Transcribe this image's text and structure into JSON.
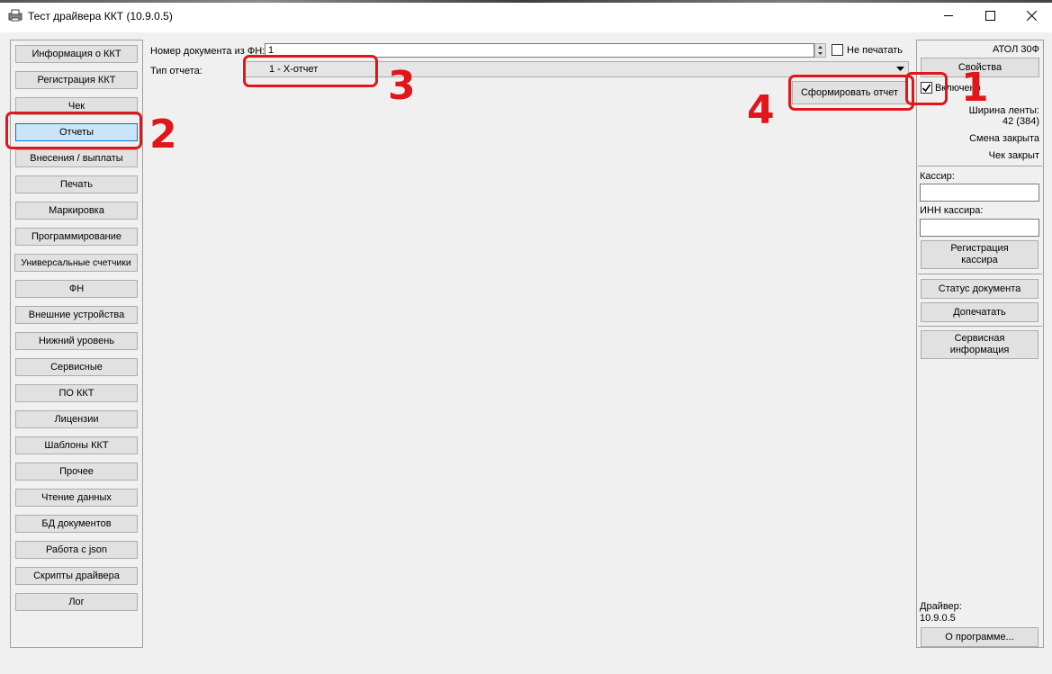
{
  "window": {
    "title": "Тест драйвера ККТ (10.9.0.5)"
  },
  "nav": {
    "items": [
      {
        "label": "Информация о ККТ"
      },
      {
        "label": "Регистрация ККТ"
      },
      {
        "label": "Чек"
      },
      {
        "label": "Отчеты"
      },
      {
        "label": "Внесения / выплаты"
      },
      {
        "label": "Печать"
      },
      {
        "label": "Маркировка"
      },
      {
        "label": "Программирование"
      },
      {
        "label": "Универсальные счетчики"
      },
      {
        "label": "ФН"
      },
      {
        "label": "Внешние устройства"
      },
      {
        "label": "Нижний уровень"
      },
      {
        "label": "Сервисные"
      },
      {
        "label": "ПО ККТ"
      },
      {
        "label": "Лицензии"
      },
      {
        "label": "Шаблоны ККТ"
      },
      {
        "label": "Прочее"
      },
      {
        "label": "Чтение данных"
      },
      {
        "label": "БД документов"
      },
      {
        "label": "Работа с json"
      },
      {
        "label": "Скрипты драйвера"
      },
      {
        "label": "Лог"
      }
    ],
    "selected": "Отчеты"
  },
  "main": {
    "doc_number_label": "Номер документа из ФН:",
    "doc_number_value": "1",
    "no_print_label": "Не печатать",
    "no_print_checked": false,
    "report_type_label": "Тип отчета:",
    "report_type_value": "1 - X-отчет",
    "generate_button": "Сформировать отчет"
  },
  "right": {
    "device_name": "АТОЛ 30Ф",
    "properties_button": "Свойства",
    "enabled_label": "Включено",
    "enabled_checked": true,
    "tape_width_label": "Ширина ленты:",
    "tape_width_value": "42 (384)",
    "shift_status": "Смена закрыта",
    "receipt_status": "Чек закрыт",
    "cashier_label": "Кассир:",
    "cashier_value": "",
    "cashier_inn_label": "ИНН кассира:",
    "cashier_inn_value": "",
    "register_cashier_button_line1": "Регистрация",
    "register_cashier_button_line2": "кассира",
    "doc_status_button": "Статус документа",
    "reprint_button": "Допечатать",
    "service_info_line1": "Сервисная",
    "service_info_line2": "информация",
    "driver_label": "Драйвер:",
    "driver_version": "10.9.0.5",
    "about_button": "О программе..."
  },
  "annotations": {
    "n1": "1",
    "n2": "2",
    "n3": "3",
    "n4": "4",
    "color": "#e0161b"
  }
}
